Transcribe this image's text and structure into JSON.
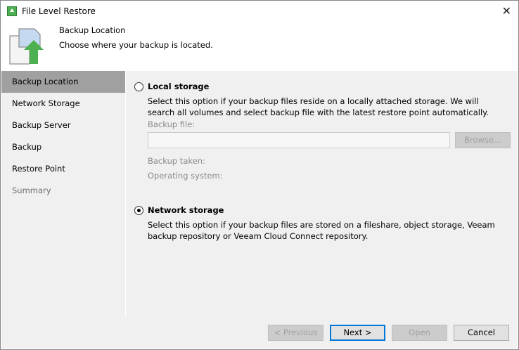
{
  "window": {
    "title": "File Level Restore"
  },
  "header": {
    "title": "Backup Location",
    "subtitle": "Choose where your backup is located."
  },
  "sidebar": {
    "items": [
      {
        "label": "Backup Location"
      },
      {
        "label": "Network Storage"
      },
      {
        "label": "Backup Server"
      },
      {
        "label": "Backup"
      },
      {
        "label": "Restore Point"
      },
      {
        "label": "Summary"
      }
    ]
  },
  "main": {
    "local": {
      "label": "Local storage",
      "desc": "Select this option if your backup files reside on a locally attached storage. We will search all volumes and select backup file with the latest restore point automatically.",
      "backup_file_label": "Backup file:",
      "backup_file_value": "",
      "browse": "Browse...",
      "backup_taken": "Backup taken:",
      "os": "Operating system:"
    },
    "network": {
      "label": "Network storage",
      "desc": "Select this option if your backup files are stored on a fileshare, object storage, Veeam backup repository or Veeam Cloud Connect repository."
    }
  },
  "footer": {
    "previous": "< Previous",
    "next": "Next >",
    "open": "Open",
    "cancel": "Cancel"
  }
}
